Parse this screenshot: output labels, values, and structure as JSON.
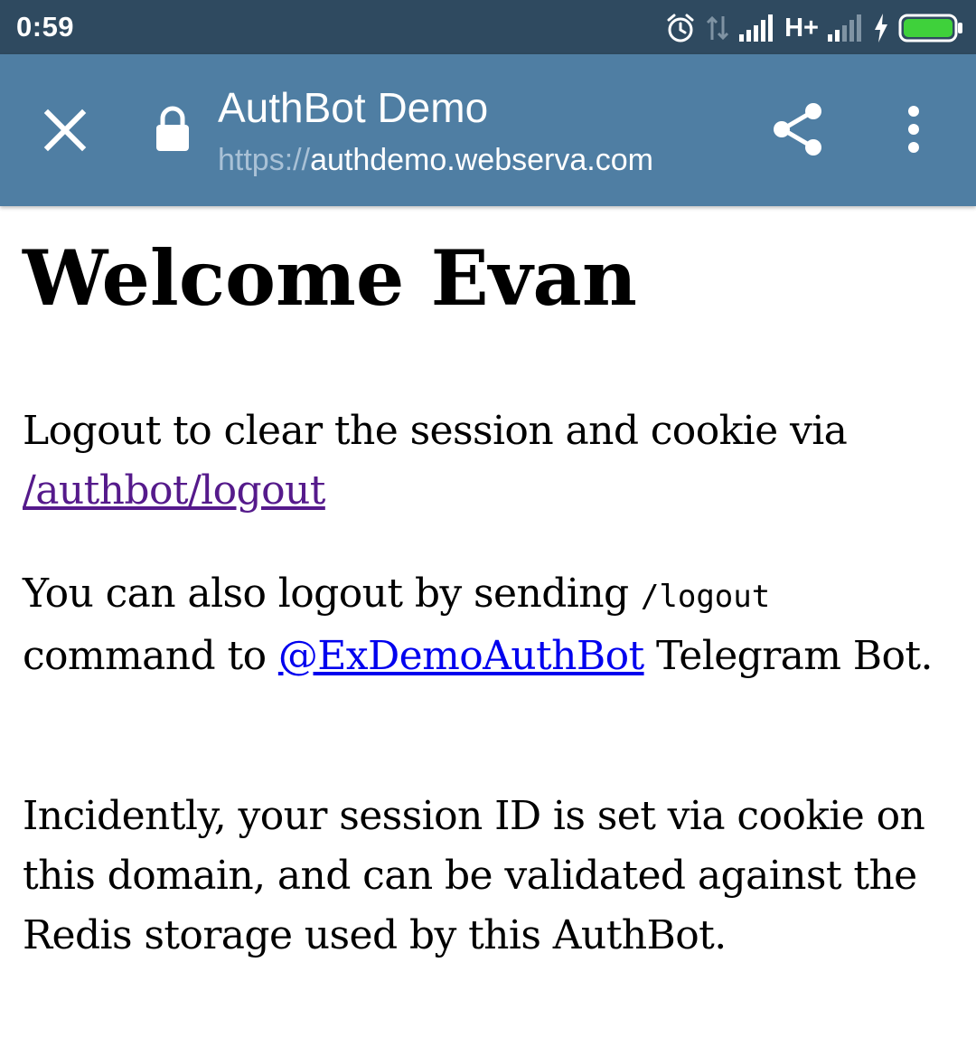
{
  "status_bar": {
    "time": "0:59",
    "network_type": "H+",
    "icons": [
      "alarm-icon",
      "data-transfer-icon",
      "signal-icon",
      "signal-weak-icon",
      "charging-icon",
      "battery-icon"
    ],
    "battery_color": "#3fd13b"
  },
  "toolbar": {
    "title": "AuthBot Demo",
    "url_scheme": "https://",
    "url_host": "authdemo.webserva.com",
    "background_color": "#4f7ea3",
    "icons": [
      "close-icon",
      "lock-icon",
      "share-icon",
      "more-vert-icon"
    ]
  },
  "content": {
    "heading": "Welcome Evan",
    "p1_text": "Logout to clear the session and cookie via ",
    "p1_link": "/authbot/logout",
    "p2_text_a": "You can also logout by sending ",
    "p2_code": "/logout",
    "p2_text_b": " command to ",
    "p2_link": "@ExDemoAuthBot",
    "p2_text_c": " Telegram Bot.",
    "p3_text": "Incidently, your session ID is set via cookie on this domain, and can be validated against the Redis storage used by this AuthBot.",
    "colors": {
      "link": "#0000ee",
      "visited_link": "#551a8b"
    }
  }
}
